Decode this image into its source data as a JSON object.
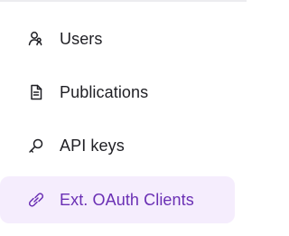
{
  "sidebar": {
    "items": [
      {
        "label": "Users",
        "icon": "users-icon",
        "active": false
      },
      {
        "label": "Publications",
        "icon": "document-icon",
        "active": false
      },
      {
        "label": "API keys",
        "icon": "key-icon",
        "active": false
      },
      {
        "label": "Ext. OAuth Clients",
        "icon": "link-icon",
        "active": true
      }
    ]
  },
  "colors": {
    "text": "#1f1f24",
    "active_text": "#6a2fb4",
    "active_background": "#f5edfd"
  }
}
